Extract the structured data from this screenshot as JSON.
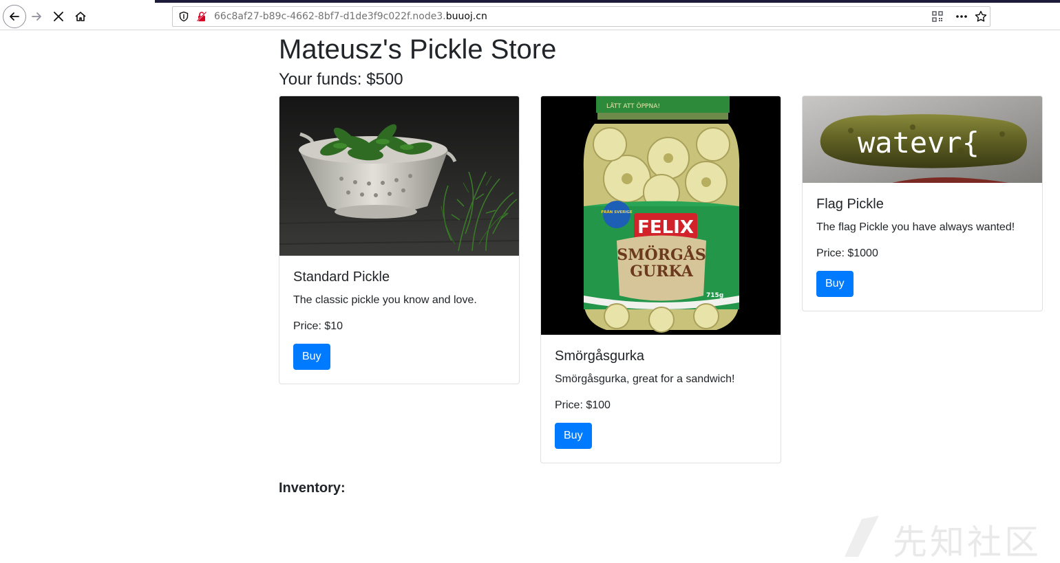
{
  "browser": {
    "url_prefix": "66c8af27-b89c-4662-8bf7-d1de3f9c022f.node3.",
    "url_domain": "buuoj.cn"
  },
  "page": {
    "title": "Mateusz's Pickle Store",
    "funds": "Your funds: $500",
    "inventory_label": "Inventory:"
  },
  "products": [
    {
      "name": "Standard Pickle",
      "description": "The classic pickle you know and love.",
      "price": "Price: $10",
      "buy_label": "Buy"
    },
    {
      "name": "Smörgåsgurka",
      "description": "Smörgåsgurka, great for a sandwich!",
      "price": "Price: $100",
      "buy_label": "Buy",
      "jar_label_brand": "FELIX",
      "jar_label_line1": "SMÖRGÅS",
      "jar_label_line2": "GURKA",
      "jar_cap_text": "LÄTT ATT ÖPPNA!",
      "jar_badge_text": "FRÅN SVERIGE",
      "jar_weight": "715g"
    },
    {
      "name": "Flag Pickle",
      "description": "The flag Pickle you have always wanted!",
      "price": "Price: $1000",
      "buy_label": "Buy",
      "image_text": "watevr{"
    }
  ],
  "watermark": {
    "text": "先知社区"
  },
  "colors": {
    "primary": "#007bff",
    "text": "#212529"
  }
}
